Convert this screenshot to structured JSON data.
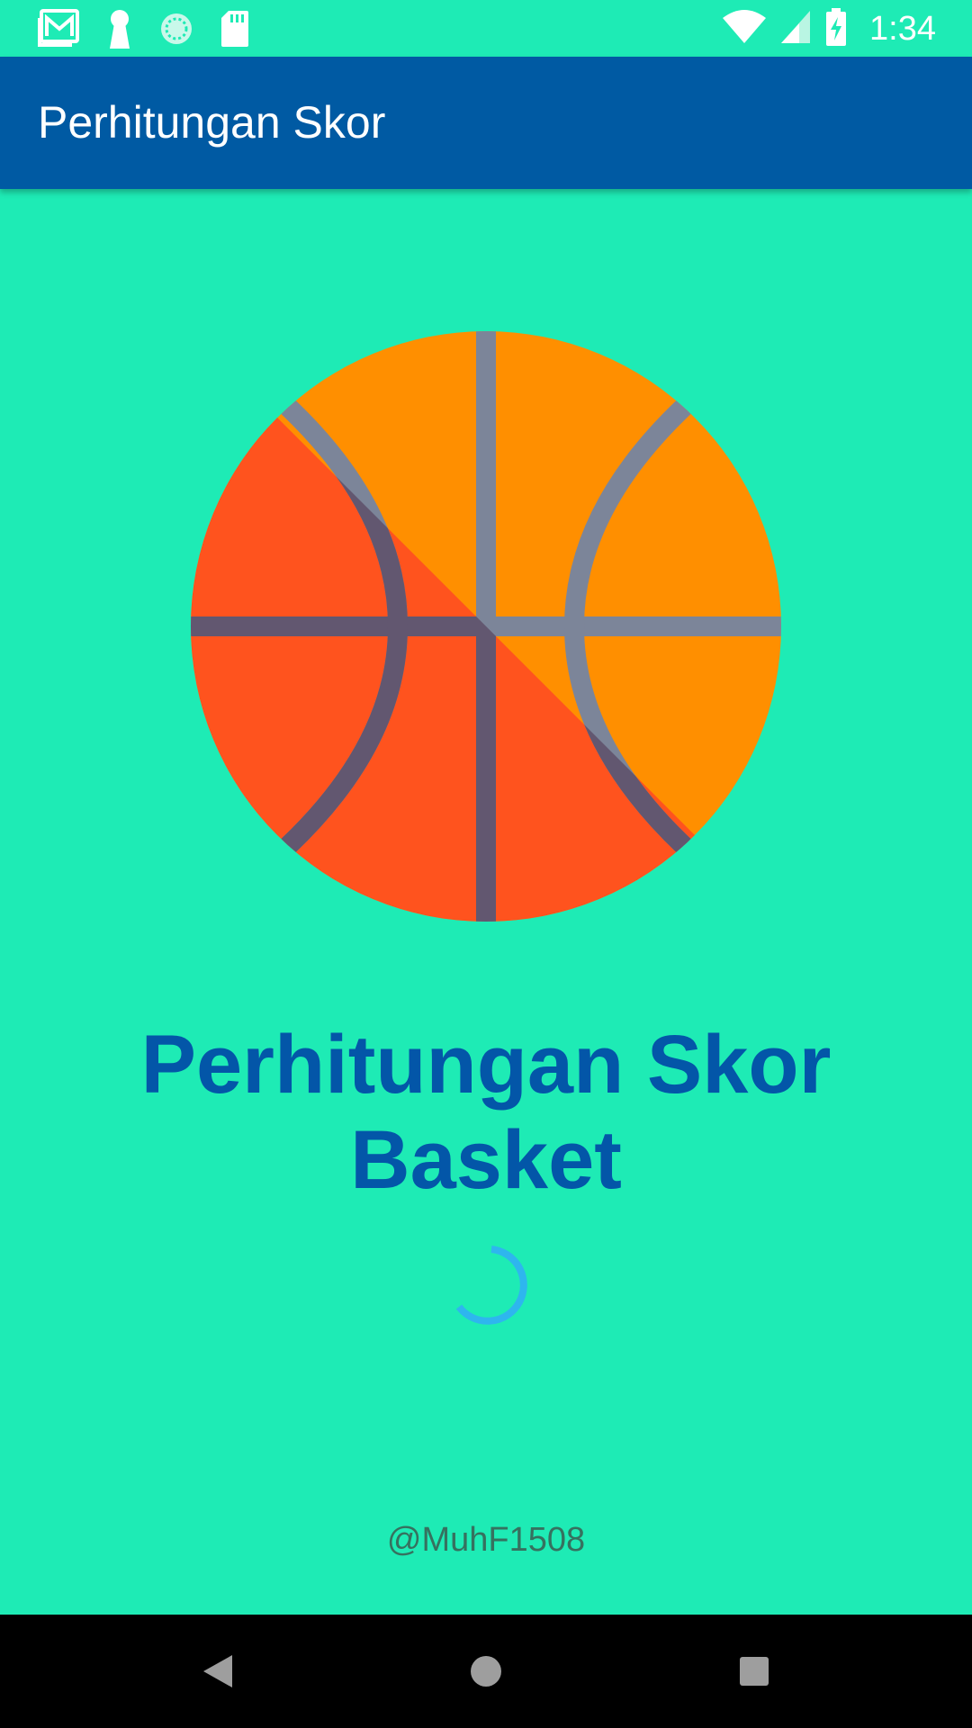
{
  "status_bar": {
    "time": "1:34",
    "left_icons": [
      "gallery-mail-icon",
      "keyhole-icon",
      "sync-circle-icon",
      "sd-card-icon"
    ],
    "right_icons": [
      "wifi-icon",
      "cell-signal-icon",
      "battery-charging-icon"
    ]
  },
  "app_bar": {
    "title": "Perhitungan Skor"
  },
  "splash": {
    "title_line1": "Perhitungan Skor",
    "title_line2": "Basket",
    "credit": "@MuhF1508",
    "logo_icon": "basketball-icon",
    "loading_icon": "loading-spinner-icon"
  },
  "nav_bar": {
    "buttons": [
      "back-icon",
      "home-icon",
      "recents-icon"
    ]
  },
  "colors": {
    "background": "#1EEBB5",
    "app_bar": "#005AA3",
    "title_text": "#0356A8",
    "ball_light": "#FF8F00",
    "ball_dark": "#FF531E",
    "ball_lines_light": "#7C8599",
    "ball_lines_dark": "#625770",
    "spinner": "#2EB6EE"
  }
}
